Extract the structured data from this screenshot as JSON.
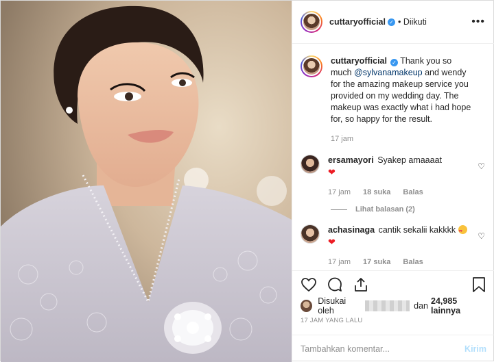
{
  "post": {
    "author": "cuttaryofficial",
    "follow_status": "• Diikuti",
    "more": "•••"
  },
  "caption": {
    "user": "cuttaryofficial",
    "mention": "@sylvanamakeup",
    "text_before": "Thank you so much",
    "text_after": "and wendy for the amazing makeup service you provided on my wedding day. The makeup was exactly what i had hope for, so happy for the result.",
    "time": "17 jam"
  },
  "comments": [
    {
      "user": "ersamayori",
      "text": "Syakep amaaaat",
      "emoji": "❤",
      "time": "17 jam",
      "likes": "18 suka",
      "reply": "Balas",
      "view_replies": "Lihat balasan (2)"
    },
    {
      "user": "achasinaga",
      "text": "cantik sekalii kakkkk",
      "emoji": "❤",
      "time": "17 jam",
      "likes": "17 suka",
      "reply": "Balas"
    }
  ],
  "likes": {
    "prefix": "Disukai oleh",
    "middle": "dan",
    "count": "24,985 lainnya"
  },
  "timestamp": "17 JAM YANG LALU",
  "add_comment": {
    "placeholder": "Tambahkan komentar...",
    "post_label": "Kirim"
  },
  "colors": {
    "link": "#003569",
    "verified": "#3897f0",
    "muted": "#8e8e8e",
    "post_disabled": "#b2dffc"
  },
  "icons": [
    "heart-icon",
    "comment-icon",
    "share-icon",
    "bookmark-icon",
    "verified-icon",
    "more-icon"
  ]
}
